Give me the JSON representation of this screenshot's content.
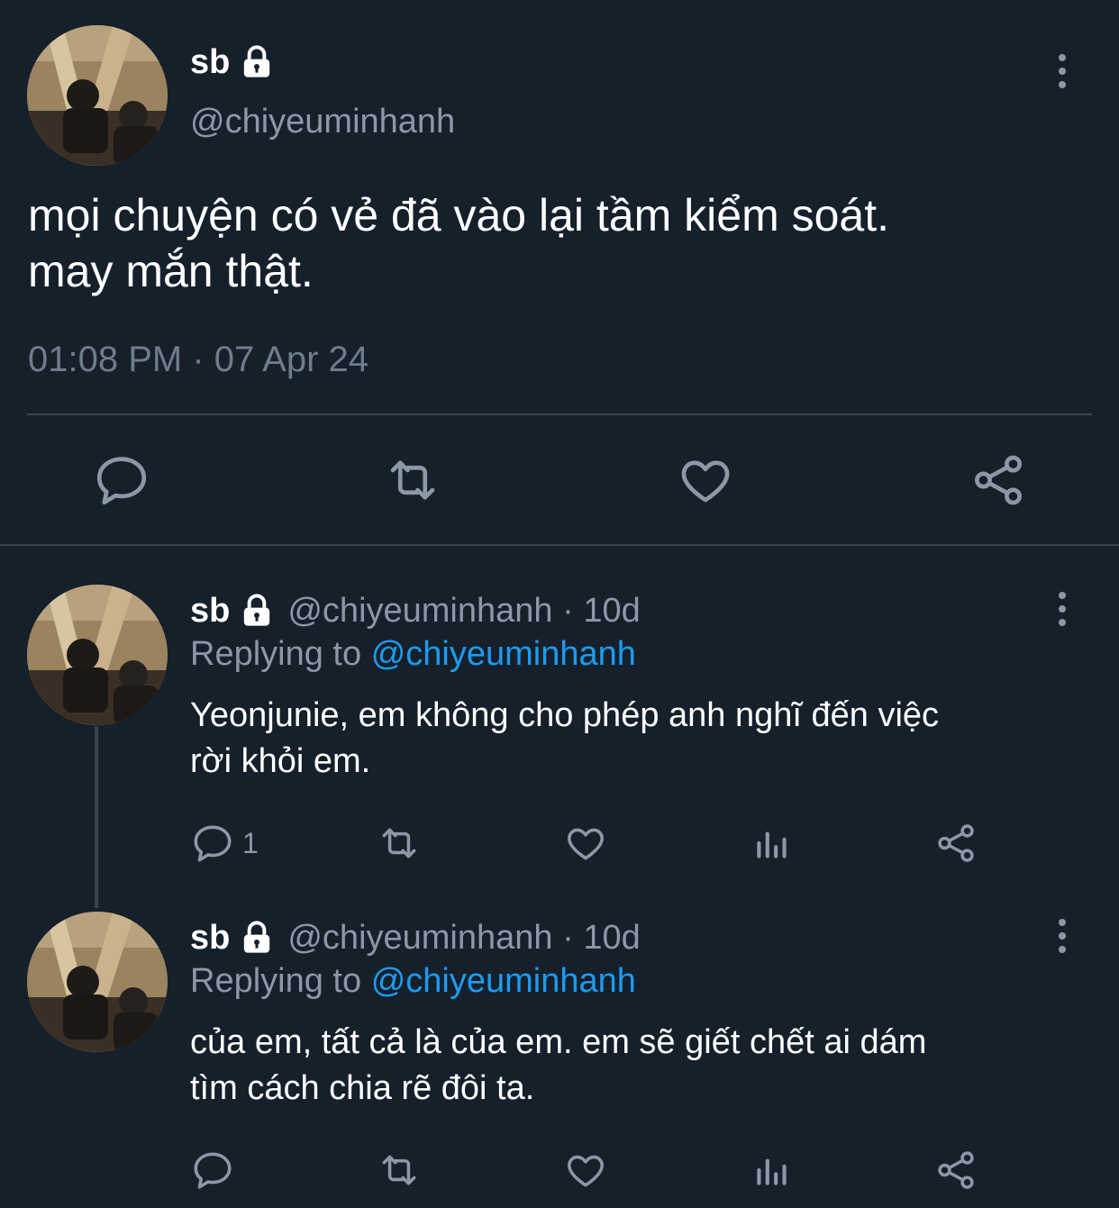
{
  "main_tweet": {
    "display_name": "sb",
    "handle": "@chiyeuminhanh",
    "text_line1": "mọi chuyện có vẻ đã vào lại tầm kiểm soát.",
    "text_line2": "may mắn thật.",
    "timestamp": "01:08 PM · 07 Apr 24",
    "actions": [
      "reply-icon",
      "retweet-icon",
      "like-icon",
      "share-icon"
    ]
  },
  "replies": [
    {
      "display_name": "sb",
      "meta": "@chiyeuminhanh · 10d",
      "replying_prefix": "Replying to",
      "replying_handle": "@chiyeuminhanh",
      "text_line1": "Yeonjunie, em không cho phép anh nghĩ đến việc",
      "text_line2": "rời khỏi em.",
      "reply_count": "1"
    },
    {
      "display_name": "sb",
      "meta": "@chiyeuminhanh · 10d",
      "replying_prefix": "Replying to",
      "replying_handle": "@chiyeuminhanh",
      "text_line1": "của em, tất cả là của em. em sẽ giết chết ai dám",
      "text_line2": "tìm cách chia rẽ đôi ta.",
      "reply_count": ""
    }
  ],
  "colors": {
    "background": "#15202b",
    "secondary_text": "#8b98a5",
    "mention": "#1d9bf0",
    "divider": "#38444d"
  }
}
